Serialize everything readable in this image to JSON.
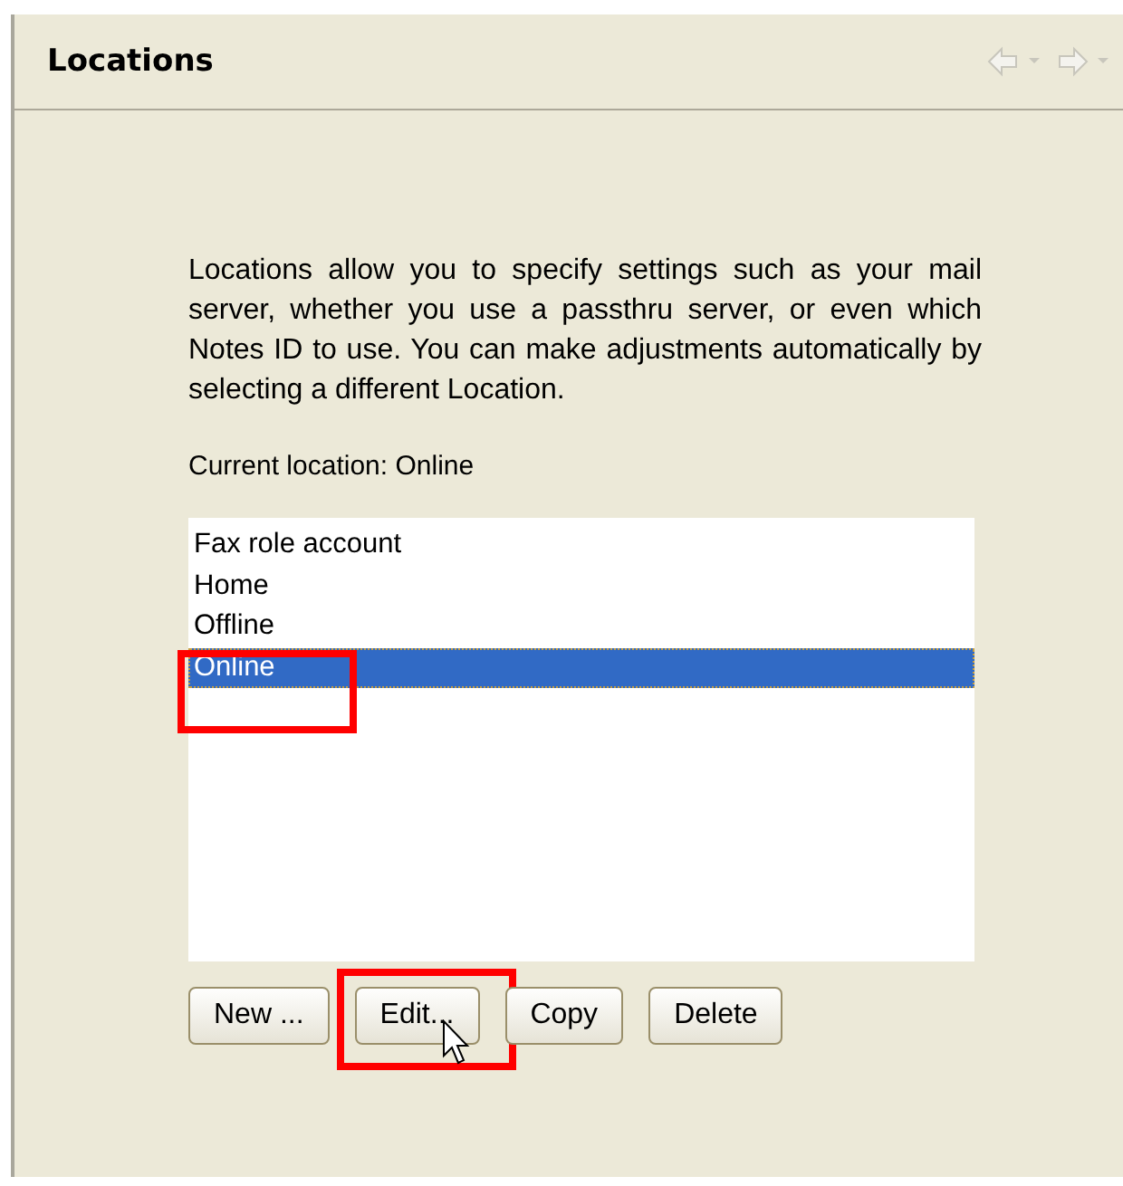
{
  "panel": {
    "title": "Locations"
  },
  "description": "Locations allow you to specify settings such as your mail server, whether you use a passthru server, or even which Notes ID to use.  You can make adjustments automatically by selecting a different Location.",
  "current_location": "Current location: Online",
  "locations": [
    {
      "label": "Fax role account",
      "selected": false,
      "highlighted": false
    },
    {
      "label": "Home",
      "selected": false,
      "highlighted": false
    },
    {
      "label": "Offline",
      "selected": false,
      "highlighted": false
    },
    {
      "label": "Online",
      "selected": true,
      "highlighted": true
    }
  ],
  "buttons": [
    {
      "label": "New ...",
      "highlighted": false
    },
    {
      "label": "Edit...",
      "highlighted": true
    },
    {
      "label": "Copy",
      "highlighted": false
    },
    {
      "label": "Delete",
      "highlighted": false
    }
  ]
}
